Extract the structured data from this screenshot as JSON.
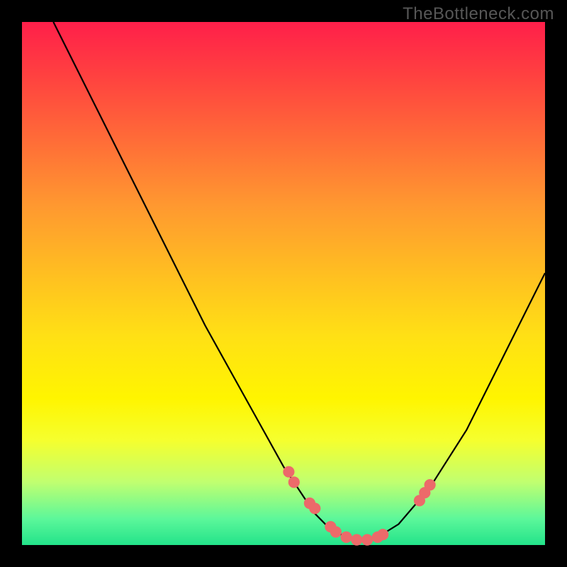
{
  "attribution": "TheBottleneck.com",
  "chart_data": {
    "type": "line",
    "title": "",
    "xlabel": "",
    "ylabel": "",
    "xlim": [
      0,
      100
    ],
    "ylim": [
      0,
      100
    ],
    "grid": false,
    "legend": false,
    "curve": {
      "name": "bottleneck-curve",
      "color": "#000000",
      "x": [
        6,
        10,
        15,
        20,
        25,
        30,
        35,
        40,
        45,
        50,
        52,
        54,
        56,
        58,
        60,
        62,
        64,
        66,
        68,
        72,
        78,
        85,
        92,
        100
      ],
      "y": [
        100,
        92,
        82,
        72,
        62,
        52,
        42,
        33,
        24,
        15,
        12,
        9,
        6,
        4,
        2.5,
        1.5,
        1,
        1,
        1.5,
        4,
        11,
        22,
        36,
        52
      ]
    },
    "markers": {
      "name": "highlight-points",
      "color": "#ec6a6a",
      "radius_pct": 1.1,
      "x": [
        51,
        52,
        55,
        56,
        59,
        60,
        62,
        64,
        66,
        68,
        69,
        76,
        77,
        78
      ],
      "y": [
        14,
        12,
        8,
        7,
        3.5,
        2.5,
        1.5,
        1,
        1,
        1.5,
        2,
        8.5,
        10,
        11.5
      ]
    }
  }
}
